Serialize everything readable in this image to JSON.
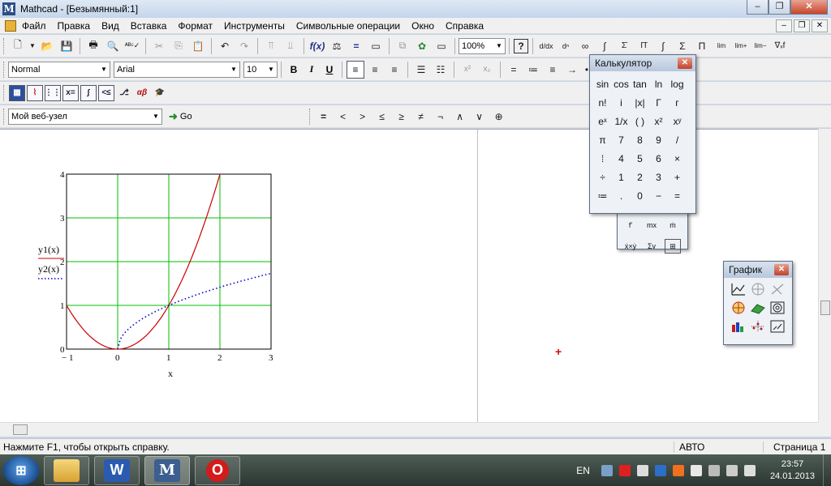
{
  "window": {
    "title": "Mathcad - [Безымянный:1]"
  },
  "menu": [
    "Файл",
    "Правка",
    "Вид",
    "Вставка",
    "Формат",
    "Инструменты",
    "Символьные операции",
    "Окно",
    "Справка"
  ],
  "toolbar": {
    "zoom": "100%",
    "style": "Normal",
    "font": "Arial",
    "font_size": "10",
    "web_address": "Мой веб-узел",
    "go_label": "Go"
  },
  "format_buttons": [
    "B",
    "I",
    "U"
  ],
  "eval_symbols": [
    "=",
    "<",
    ">",
    "≤",
    "≥",
    "≠",
    "¬",
    "∧",
    "∨",
    "⊕"
  ],
  "plot": {
    "legend": [
      "y1(x)",
      "y2(x)"
    ],
    "xlabel": "x",
    "x_ticks": [
      "− 1",
      "0",
      "1",
      "2",
      "3"
    ],
    "y_ticks": [
      "0",
      "1",
      "2",
      "3",
      "4"
    ],
    "colors": {
      "y1": "#cc0000",
      "y2": "#0000cc",
      "grid": "#00c000"
    }
  },
  "chart_data": {
    "type": "line",
    "xlabel": "x",
    "ylabel": "",
    "xlim": [
      -1,
      3
    ],
    "ylim": [
      0,
      4
    ],
    "grid": true,
    "series": [
      {
        "name": "y1(x)",
        "style": "solid",
        "x": [
          -1,
          -0.5,
          0,
          0.5,
          1,
          1.5,
          2
        ],
        "values": [
          1,
          0.25,
          0,
          0.25,
          1,
          2.25,
          4
        ]
      },
      {
        "name": "y2(x)",
        "style": "dotted",
        "x": [
          0,
          0.25,
          0.5,
          1,
          1.5,
          2,
          2.5,
          3
        ],
        "values": [
          0,
          0.5,
          0.71,
          1,
          1.22,
          1.41,
          1.58,
          1.73
        ]
      }
    ]
  },
  "calculator": {
    "title": "Калькулятор",
    "keys": [
      "sin",
      "cos",
      "tan",
      "ln",
      "log",
      "n!",
      "i",
      "|x|",
      "Γ",
      "ᴦ",
      "eˣ",
      "1/x",
      "( )",
      "x²",
      "xʸ",
      "π",
      "7",
      "8",
      "9",
      "/",
      "⁞",
      "4",
      "5",
      "6",
      "×",
      "÷",
      "1",
      "2",
      "3",
      "+",
      "≔",
      ".",
      "0",
      "−",
      "="
    ]
  },
  "hidden_palette": {
    "row1": [
      "f'",
      "mx",
      "ṁ"
    ],
    "row2": [
      "ẋ×ẏ",
      "Σv",
      "⊞"
    ]
  },
  "graph_palette": {
    "title": "График"
  },
  "status": {
    "help": "Нажмите F1, чтобы открыть справку.",
    "mode": "АВТО",
    "page": "Страница 1"
  },
  "taskbar": {
    "lang": "EN",
    "time": "23:57",
    "date": "24.01.2013",
    "apps": [
      "explorer",
      "word",
      "mathcad",
      "opera"
    ]
  }
}
